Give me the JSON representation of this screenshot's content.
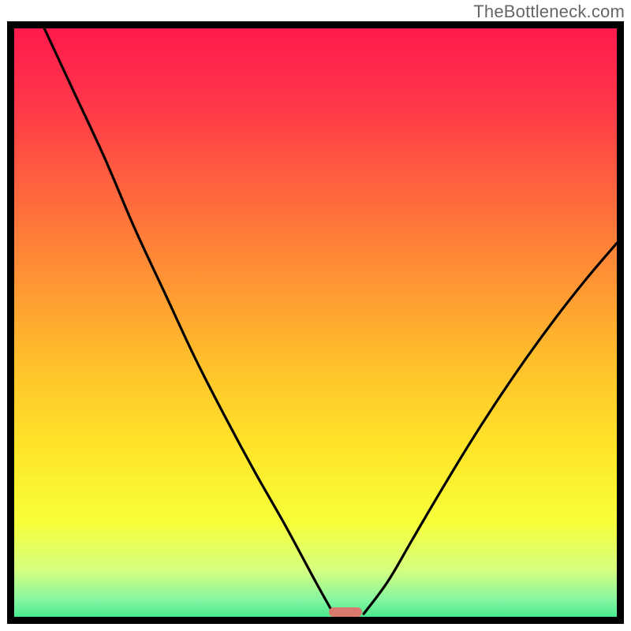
{
  "watermark": "TheBottleneck.com",
  "colors": {
    "border": "#000000",
    "marker": "#d9786d",
    "gradient_stops": [
      {
        "pos": 0.0,
        "hex": "#ff1a4d"
      },
      {
        "pos": 0.12,
        "hex": "#ff3549"
      },
      {
        "pos": 0.25,
        "hex": "#ff5f3f"
      },
      {
        "pos": 0.4,
        "hex": "#ff8e35"
      },
      {
        "pos": 0.55,
        "hex": "#ffbf2b"
      },
      {
        "pos": 0.7,
        "hex": "#ffe629"
      },
      {
        "pos": 0.82,
        "hex": "#f7ff3a"
      },
      {
        "pos": 0.9,
        "hex": "#d4ff80"
      },
      {
        "pos": 0.95,
        "hex": "#82f5a1"
      },
      {
        "pos": 1.0,
        "hex": "#16e27e"
      }
    ]
  },
  "chart_data": {
    "type": "line",
    "title": "",
    "xlabel": "",
    "ylabel": "",
    "xlim": [
      0,
      100
    ],
    "ylim": [
      0,
      100
    ],
    "marker": {
      "x_center": 55.0,
      "width": 5.5,
      "y": 0
    },
    "series": [
      {
        "name": "left-branch",
        "x": [
          5.0,
          10.0,
          15.0,
          20.0,
          25.0,
          30.0,
          35.0,
          40.0,
          45.0,
          50.0,
          53.0
        ],
        "y": [
          100.0,
          89.0,
          78.0,
          66.0,
          55.0,
          44.0,
          34.0,
          24.5,
          15.5,
          6.0,
          0.5
        ]
      },
      {
        "name": "right-branch",
        "x": [
          58.0,
          62.0,
          66.0,
          70.0,
          75.0,
          80.0,
          85.0,
          90.0,
          95.0,
          100.0
        ],
        "y": [
          0.5,
          6.0,
          13.0,
          20.0,
          28.5,
          36.5,
          44.0,
          51.0,
          57.5,
          63.5
        ]
      }
    ]
  }
}
